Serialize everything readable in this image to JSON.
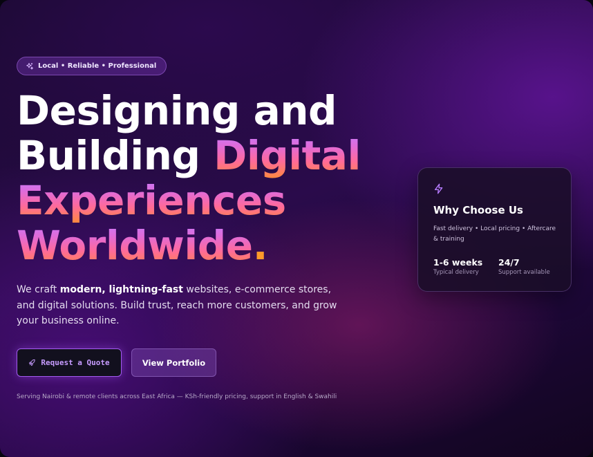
{
  "badge": {
    "icon": "sparkles-icon",
    "text": "Local • Reliable • Professional"
  },
  "headline": {
    "line1": "Designing and",
    "line2_plain": "Building ",
    "line2_highlight": "Digital",
    "line3": "Experiences",
    "line4": "Worldwide",
    "line4_dot": "."
  },
  "lead": {
    "prefix": "We craft ",
    "emphasis": "modern, lightning-fast",
    "suffix": " websites, e-commerce stores, and digital solutions. Build trust, reach more customers, and grow your business online."
  },
  "buttons": {
    "quote_icon": "rocket-icon",
    "quote_label": "Request a Quote",
    "portfolio_label": "View Portfolio"
  },
  "footnote": "Serving Nairobi & remote clients across East Africa — KSh-friendly pricing, support in English & Swahili",
  "card": {
    "icon": "lightning-icon",
    "title": "Why Choose Us",
    "description": "Fast delivery • Local pricing • Aftercare & training",
    "stats": [
      {
        "value": "1-6 weeks",
        "label": "Typical delivery"
      },
      {
        "value": "24/7",
        "label": "Support available"
      }
    ]
  },
  "colors": {
    "accent_purple": "#c57bff",
    "accent_pink": "#ff6a9a",
    "accent_orange": "#ff8a3a",
    "button_border": "#a35cf0"
  }
}
